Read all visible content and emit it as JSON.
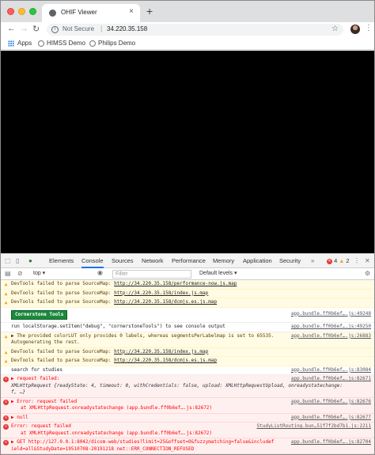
{
  "browser": {
    "tab_title": "OHIF Viewer",
    "tab_close": "×",
    "new_tab": "+",
    "security_label": "Not Secure",
    "url": "34.220.35.158",
    "bookmarks": [
      "Apps",
      "HIMSS Demo",
      "Philips Demo"
    ]
  },
  "devtools": {
    "tabs": [
      "Elements",
      "Console",
      "Sources",
      "Network",
      "Performance",
      "Memory",
      "Application",
      "Security"
    ],
    "active_tab": "Console",
    "error_count": "4",
    "warning_count": "2",
    "context": "top",
    "filter_placeholder": "Filter",
    "levels_label": "Default levels ▾"
  },
  "console": {
    "w1": "DevTools failed to parse SourceMap:",
    "w1_link": "http://34.220.35.158/performance-now.js.map",
    "w2": "DevTools failed to parse SourceMap:",
    "w2_link": "http://34.220.35.158/index.js.map",
    "w3": "DevTools failed to parse SourceMap:",
    "w3_link": "http://34.220.35.158/dcmjs.es.js.map",
    "badge": "Cornerstone Tools",
    "src_a": "app.bundle.ff0b6ef….js:49248",
    "info1": "run localStorage.setItem(\"debug\", \"cornerstoneTools\") to see console output",
    "src_b": "app.bundle.ff0b6ef….js:49250",
    "w4a": "▶ The provided colorLUT only provides 0 labels, whereas segmentsPerLabelmap is set to 65535.",
    "w4b": "Autogenerating the rest.",
    "src_c": "app.bundle.ff0b6ef….js:26883",
    "w5": "DevTools failed to parse SourceMap:",
    "w5_link": "http://34.220.35.158/index.js.map",
    "w6": "DevTools failed to parse SourceMap:",
    "w6_link": "http://34.220.35.158/dcmjs.es.js.map",
    "info2": "search for studies",
    "src_d": "app.bundle.ff0b6ef….js:83084",
    "e1a": "▶ request failed:",
    "e1b": "XMLHttpRequest {readyState: 4, timeout: 0, withCredentials: false, upload: XMLHttpRequestUpload, onreadystatechange:",
    "e1c": "f, …}",
    "src_e": "app.bundle.ff0b6ef….js:82671",
    "e2a": "▶ Error: request failed",
    "e2b": "at XMLHttpRequest.onreadystatechange (app.bundle.ff0b6ef….js:82672)",
    "src_f": "app.bundle.ff0b6ef….js:82676",
    "e3": "▶ null",
    "src_g": "app.bundle.ff0b6ef….js:82677",
    "e4a": "Error: request failed",
    "e4b": "at XMLHttpRequest.onreadystatechange (app.bundle.ff0b6ef….js:82672)",
    "src_h": "StudyListRouting.bun…51f7f2bd7b1.js:2211",
    "src_i": "app.bundle.ff0b6ef….js:82704",
    "e5a": "▶ GET http://127.0.0.1:8042/dicom-web/studies?limit=25&offset=0&fuzzymatching=false&includef",
    "e5b": "ield=all&StudyDate=19510708-20191218",
    "e5c": "net::ERR_CONNECTION_REFUSED",
    "prompt": ">"
  }
}
